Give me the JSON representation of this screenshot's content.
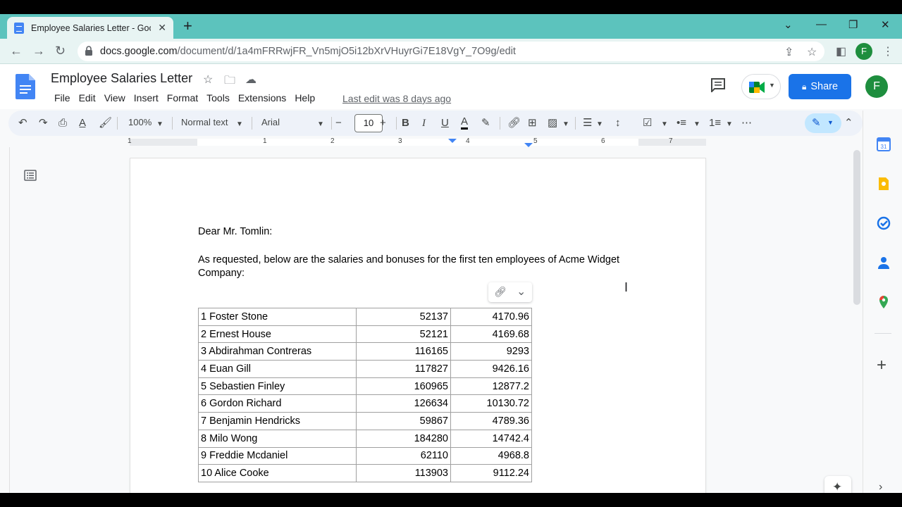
{
  "browser": {
    "tab_title": "Employee Salaries Letter - Google Docs",
    "new_tab": "+",
    "url_host": "docs.google.com",
    "url_path": "/document/d/1a4mFRRwjFR_Vn5mjO5i12bXrVHuyrGi7E18VgY_7O9g/edit",
    "profile_initial": "F"
  },
  "docs": {
    "title": "Employee Salaries Letter",
    "menu": [
      "File",
      "Edit",
      "View",
      "Insert",
      "Format",
      "Tools",
      "Extensions",
      "Help"
    ],
    "last_edit": "Last edit was 8 days ago",
    "share_label": "Share",
    "user_initial": "F"
  },
  "toolbar": {
    "zoom": "100%",
    "style": "Normal text",
    "font": "Arial",
    "font_size": "10"
  },
  "ruler": {
    "marks": [
      "1",
      "1",
      "2",
      "3",
      "4",
      "5",
      "6",
      "7"
    ]
  },
  "document": {
    "greeting": "Dear Mr. Tomlin:",
    "intro": "As requested, below are the salaries and bonuses for the first ten employees of Acme Widget Company:",
    "rows": [
      {
        "name": "1 Foster Stone",
        "salary": "52137",
        "bonus": "4170.96"
      },
      {
        "name": "2 Ernest House",
        "salary": "52121",
        "bonus": "4169.68"
      },
      {
        "name": "3 Abdirahman Contreras",
        "salary": "116165",
        "bonus": "9293"
      },
      {
        "name": "4 Euan Gill",
        "salary": "117827",
        "bonus": "9426.16"
      },
      {
        "name": "5 Sebastien Finley",
        "salary": "160965",
        "bonus": "12877.2"
      },
      {
        "name": "6 Gordon Richard",
        "salary": "126634",
        "bonus": "10130.72"
      },
      {
        "name": "7 Benjamin Hendricks",
        "salary": "59867",
        "bonus": "4789.36"
      },
      {
        "name": "8 Milo Wong",
        "salary": "184280",
        "bonus": "14742.4"
      },
      {
        "name": "9 Freddie Mcdaniel",
        "salary": "62110",
        "bonus": "4968.8"
      },
      {
        "name": "10 Alice Cooke",
        "salary": "113903",
        "bonus": "9112.24"
      }
    ]
  },
  "colors": {
    "tab_strip": "#5cc3bd",
    "share_button": "#1a73e8",
    "avatar": "#1e8e3e",
    "docs_blue": "#4285f4"
  }
}
